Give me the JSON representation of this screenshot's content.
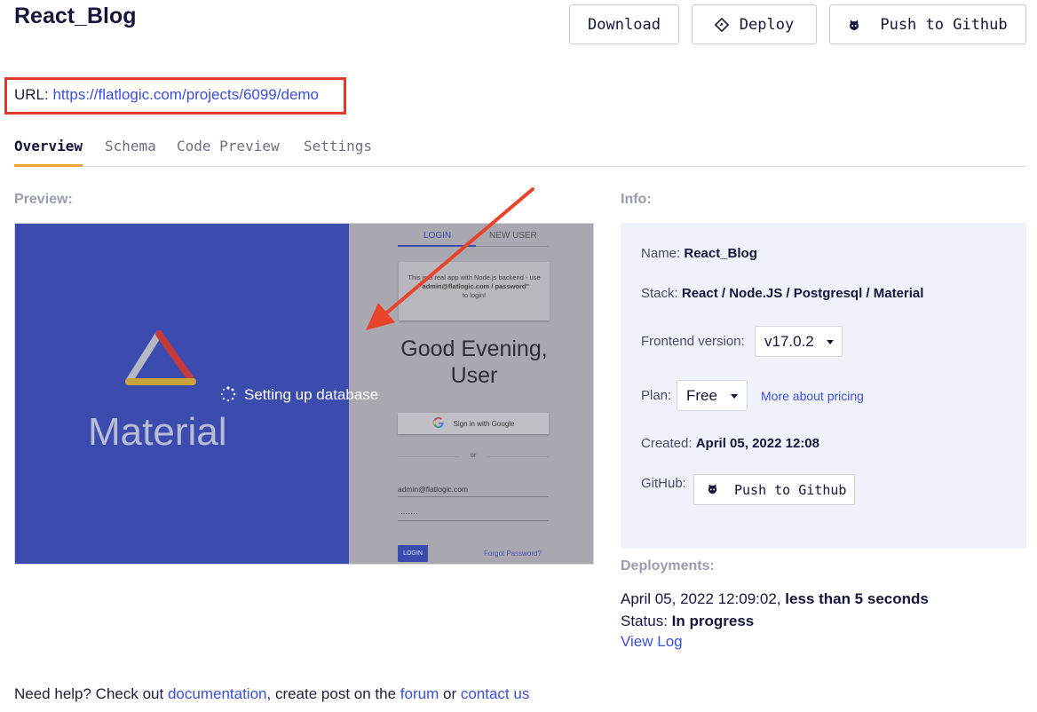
{
  "header": {
    "title": "React_Blog",
    "download_label": "Download",
    "deploy_label": "Deploy",
    "push_label": "Push to Github"
  },
  "url": {
    "label": "URL:",
    "link": "https://flatlogic.com/projects/6099/demo"
  },
  "tabs": [
    {
      "label": "Overview",
      "active": true
    },
    {
      "label": "Schema",
      "active": false
    },
    {
      "label": "Code Preview",
      "active": false
    },
    {
      "label": "Settings",
      "active": false
    }
  ],
  "preview": {
    "label": "Preview:",
    "brand_text": "Material",
    "loading_text": "Setting up database",
    "login_tab": "LOGIN",
    "new_user_tab": "NEW USER",
    "card_line1": "This is a real app with Node.js backend - use",
    "card_line2": "\"admin@flatlogic.com / password\"",
    "card_line3": "to login!",
    "greeting_line1": "Good Evening,",
    "greeting_line2": "User",
    "google_button": "Sign in with Google",
    "or_text": "or",
    "email_value": "admin@flatlogic.com",
    "password_value": "········",
    "login_button": "LOGIN",
    "forgot_link": "Forgot Password?"
  },
  "info": {
    "label": "Info:",
    "name_label": "Name:",
    "name_value": "React_Blog",
    "stack_label": "Stack:",
    "stack_value": "React / Node.JS / Postgresql / Material",
    "frontend_label": "Frontend version:",
    "frontend_value": "v17.0.2",
    "plan_label": "Plan:",
    "plan_value": "Free",
    "pricing_link": "More about pricing",
    "created_label": "Created:",
    "created_value": "April 05, 2022 12:08",
    "github_label": "GitHub:",
    "github_button": "Push to Github"
  },
  "deployments": {
    "label": "Deployments:",
    "date": "April 05, 2022 12:09:02,",
    "duration": "less than 5 seconds",
    "status_label": "Status:",
    "status_value": "In progress",
    "view_log": "View Log"
  },
  "help": {
    "prefix": "Need help? Check out",
    "documentation": "documentation",
    "middle": ", create post on the",
    "forum": "forum",
    "or": "or",
    "contact": "contact us"
  },
  "colors": {
    "accent": "#3b4fd8",
    "tab_underline": "#f2a33c",
    "highlight_box": "#e03a2b",
    "arrow": "#e8432b",
    "material_blue": "#3c4cae"
  },
  "icons": {
    "deploy": "diamond-arrow-icon",
    "github": "github-icon",
    "spinner": "loading-spinner-icon",
    "google": "google-logo-icon",
    "brand": "triangle-logo-icon"
  }
}
